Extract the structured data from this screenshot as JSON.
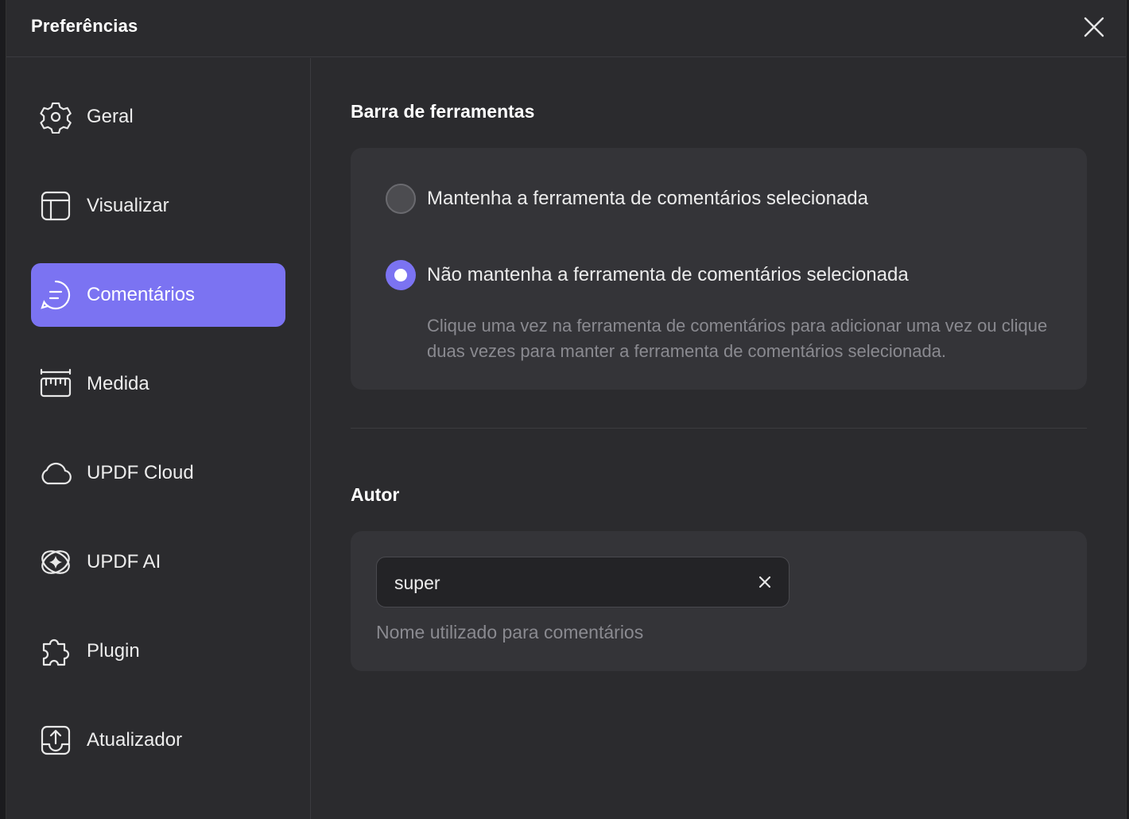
{
  "window": {
    "title": "Preferências",
    "close_icon": "close-icon"
  },
  "sidebar": {
    "items": [
      {
        "label": "Geral",
        "icon": "gear-icon",
        "active": false
      },
      {
        "label": "Visualizar",
        "icon": "layout-icon",
        "active": false
      },
      {
        "label": "Comentários",
        "icon": "comment-icon",
        "active": true
      },
      {
        "label": "Medida",
        "icon": "ruler-icon",
        "active": false
      },
      {
        "label": "UPDF Cloud",
        "icon": "cloud-icon",
        "active": false
      },
      {
        "label": "UPDF AI",
        "icon": "ai-sparkle-icon",
        "active": false
      },
      {
        "label": "Plugin",
        "icon": "puzzle-icon",
        "active": false
      },
      {
        "label": "Atualizador",
        "icon": "update-icon",
        "active": false
      }
    ]
  },
  "toolbar_section": {
    "title": "Barra de ferramentas",
    "options": [
      {
        "label": "Mantenha a ferramenta de comentários selecionada",
        "selected": false
      },
      {
        "label": "Não mantenha a ferramenta de comentários selecionada",
        "selected": true
      }
    ],
    "hint": "Clique uma vez na ferramenta de comentários para adicionar uma vez ou clique duas vezes para manter a ferramenta de comentários selecionada."
  },
  "author_section": {
    "title": "Autor",
    "value": "super",
    "hint": "Nome utilizado para comentários"
  },
  "colors": {
    "accent": "#7b73f2",
    "background": "#2b2b2e",
    "card": "#343438"
  }
}
